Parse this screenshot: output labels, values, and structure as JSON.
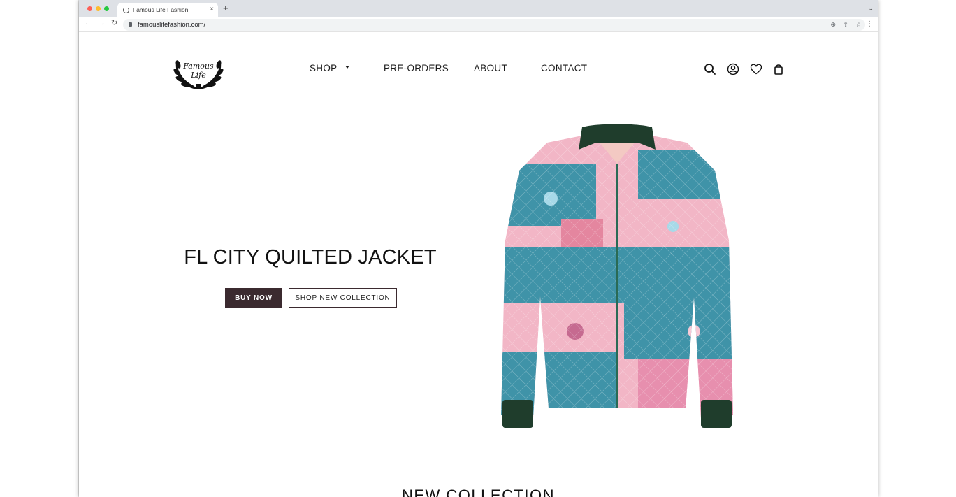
{
  "browser": {
    "tab_title": "Famous Life Fashion",
    "tab_close": "×",
    "new_tab": "+",
    "url": "famouslifefashion.com/"
  },
  "site": {
    "logo_text": "Famous Life",
    "nav": {
      "shop": "SHOP",
      "preorders": "PRE-ORDERS",
      "about": "ABOUT",
      "contact": "CONTACT"
    },
    "header_icons": [
      "search-icon",
      "account-icon",
      "wishlist-heart-icon",
      "cart-bag-icon"
    ]
  },
  "hero": {
    "title": "FL CITY QUILTED JACKET",
    "buy_now": "BUY NOW",
    "shop_collection": "SHOP NEW COLLECTION"
  },
  "section": {
    "title": "NEW COLLECTION"
  },
  "colors": {
    "primary_button": "#3b2a2f",
    "jacket_pink": "#f2b6c6",
    "jacket_teal": "#3f93a8",
    "jacket_collar": "#1f3d2c"
  }
}
